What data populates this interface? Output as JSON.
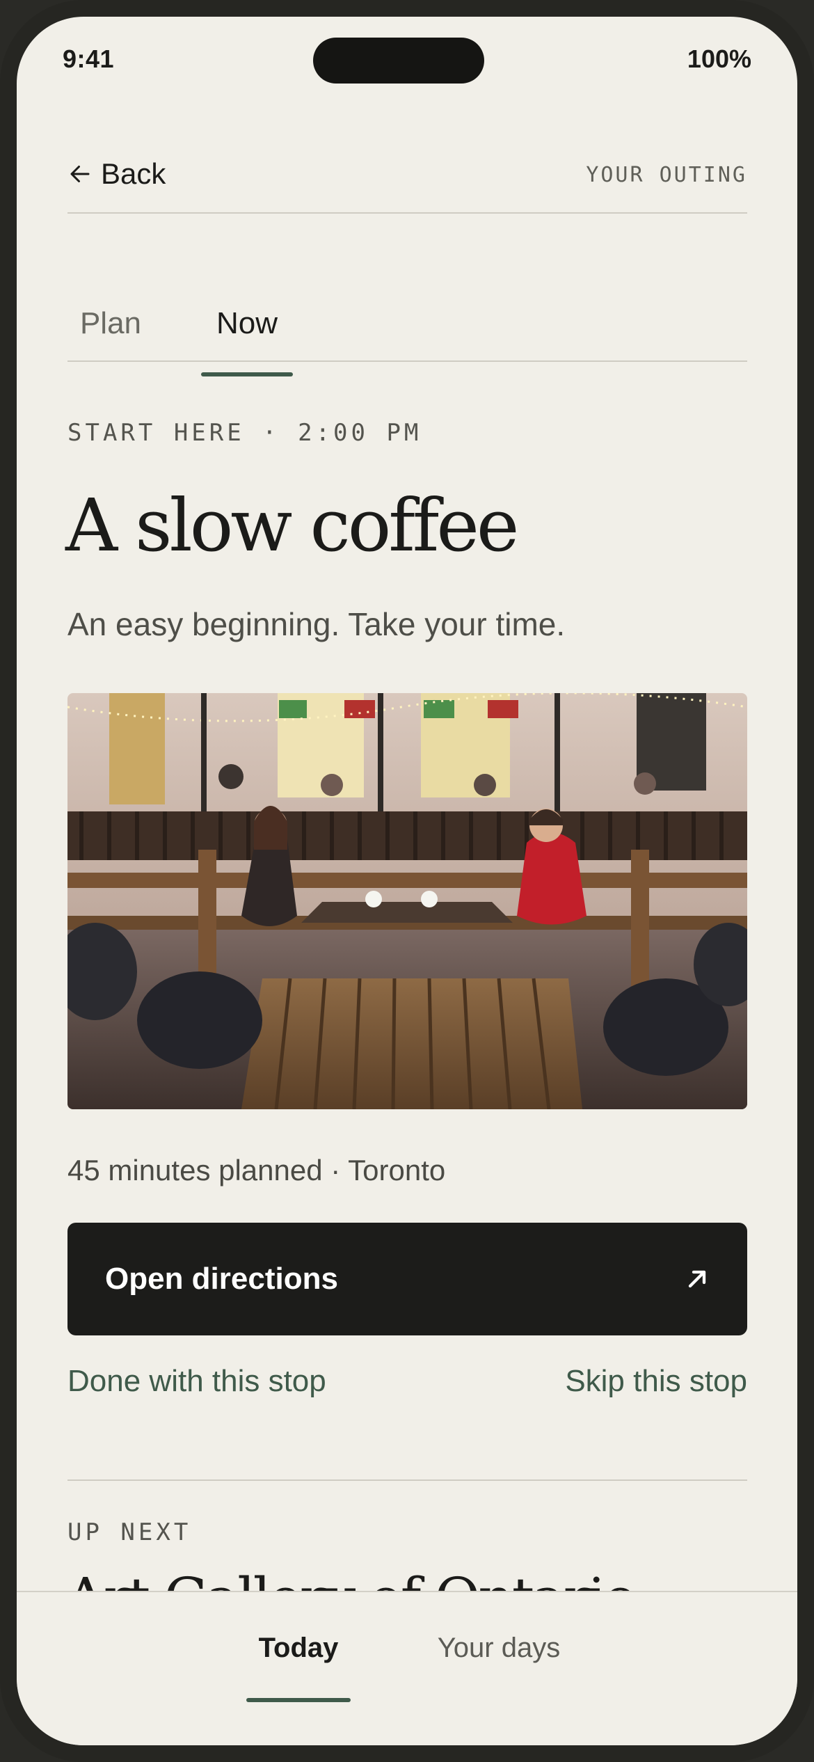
{
  "status_bar": {
    "time": "9:41",
    "battery": "100%"
  },
  "header": {
    "back_label": "Back",
    "eyebrow": "YOUR OUTING"
  },
  "tabs": [
    {
      "label": "Plan",
      "selected": false
    },
    {
      "label": "Now",
      "selected": true
    }
  ],
  "stop": {
    "kicker": "START HERE · 2:00 PM",
    "title": "A slow coffee",
    "subtitle": "An easy beginning. Take your time.",
    "meta": "45 minutes planned · Toronto"
  },
  "actions": {
    "primary_label": "Open directions",
    "done_label": "Done with this stop",
    "skip_label": "Skip this stop"
  },
  "up_next": {
    "label": "UP NEXT",
    "title": "Art Gallery of Ontario"
  },
  "bottom_nav": [
    {
      "label": "Today",
      "selected": true
    },
    {
      "label": "Your days",
      "selected": false
    }
  ],
  "colors": {
    "background": "#f1efe8",
    "accent": "#3f5a4a",
    "button": "#1c1c1a",
    "text": "#1b1b19"
  },
  "icons": {
    "back": "arrow-left-icon",
    "directions": "arrow-up-right-icon"
  }
}
